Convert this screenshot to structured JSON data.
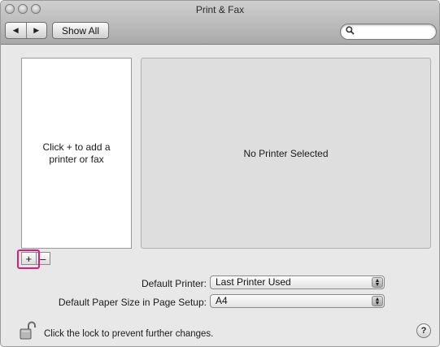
{
  "window": {
    "title": "Print & Fax"
  },
  "toolbar": {
    "back_icon": "◀",
    "forward_icon": "▶",
    "show_all_label": "Show All",
    "search_value": ""
  },
  "printer_list": {
    "empty_message": "Click + to add a printer or fax"
  },
  "detail": {
    "message": "No Printer Selected"
  },
  "list_controls": {
    "add_label": "+",
    "remove_label": "–"
  },
  "settings": {
    "default_printer_label": "Default Printer:",
    "default_printer_value": "Last Printer Used",
    "paper_size_label": "Default Paper Size in Page Setup:",
    "paper_size_value": "A4"
  },
  "footer": {
    "lock_text": "Click the lock to prevent further changes.",
    "help_label": "?"
  },
  "colors": {
    "highlight": "#e0197f"
  }
}
